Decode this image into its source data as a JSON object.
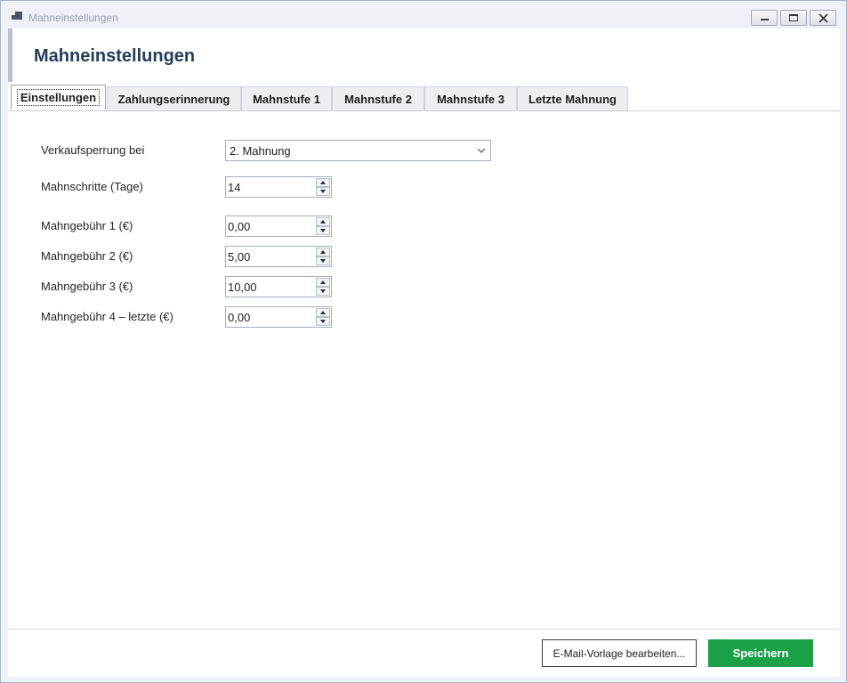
{
  "window": {
    "title": "Mahneinstellungen",
    "controls": [
      "minimize-icon",
      "restore-icon",
      "close-icon"
    ]
  },
  "header": {
    "title": "Mahneinstellungen"
  },
  "tabs": [
    {
      "label": "Einstellungen",
      "active": true
    },
    {
      "label": "Zahlungserinnerung",
      "active": false
    },
    {
      "label": "Mahnstufe 1",
      "active": false
    },
    {
      "label": "Mahnstufe 2",
      "active": false
    },
    {
      "label": "Mahnstufe 3",
      "active": false
    },
    {
      "label": "Letzte Mahnung",
      "active": false
    }
  ],
  "form": {
    "sales_block": {
      "label": "Verkaufsperrung bei",
      "value": "2. Mahnung"
    },
    "dunning_steps": {
      "label": "Mahnschritte (Tage)",
      "value": "14"
    },
    "fee_1": {
      "label": "Mahngebühr 1 (€)",
      "value": "0,00"
    },
    "fee_2": {
      "label": "Mahngebühr 2 (€)",
      "value": "5,00"
    },
    "fee_3": {
      "label": "Mahngebühr 3 (€)",
      "value": "10,00"
    },
    "fee_4": {
      "label": "Mahngebühr 4 – letzte (€)",
      "value": "0,00"
    }
  },
  "footer": {
    "edit_template_label": "E-Mail-Vorlage bearbeiten...",
    "save_label": "Speichern"
  },
  "colors": {
    "header_title": "#253d5b",
    "save_button": "#1aa148",
    "window_bg": "#eef1f6"
  }
}
